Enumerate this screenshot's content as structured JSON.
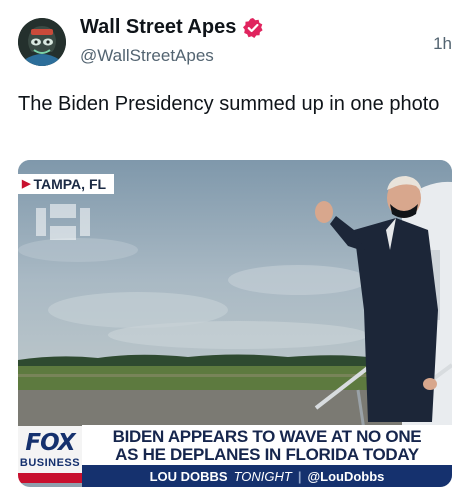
{
  "author": {
    "display_name": "Wall Street Apes",
    "handle": "@WallStreetApes",
    "avatar_icon": "gorilla-avatar-icon",
    "verified_icon": "verified-badge-icon",
    "verified_color": "#e0245e"
  },
  "timestamp": "1h",
  "tweet": {
    "text": "The Biden Presidency summed up in one photo"
  },
  "media": {
    "location_tag": "TAMPA, FL",
    "network_logo": "FOX",
    "network_sub": "BUSINESS",
    "chyron_line1": "BIDEN APPEARS TO WAVE AT NO ONE",
    "chyron_line2": "AS HE DEPLANES IN FLORIDA TODAY",
    "show_name": "LOU DOBBS",
    "show_suffix": "TONIGHT",
    "show_handle": "@LouDobbs",
    "brand_colors": {
      "navy": "#15316e",
      "red": "#c8102e"
    }
  }
}
